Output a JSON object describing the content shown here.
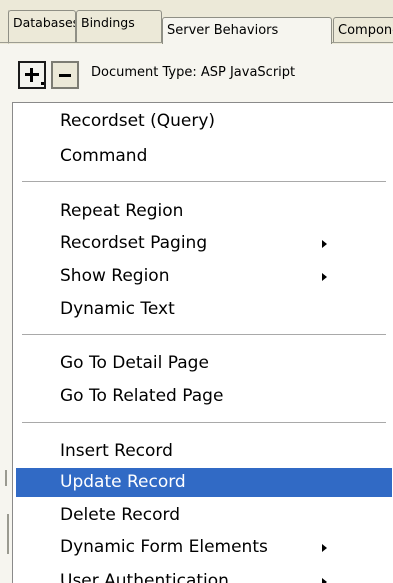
{
  "tabs": [
    {
      "label": "Databases"
    },
    {
      "label": "Bindings"
    },
    {
      "label": "Server Behaviors"
    },
    {
      "label": "Components"
    }
  ],
  "toolbar": {
    "plus_icon": "plus-icon",
    "minus_icon": "minus-icon",
    "document_type": "Document Type: ASP JavaScript"
  },
  "menu": {
    "items": [
      {
        "label": "Recordset (Query)"
      },
      {
        "label": "Command"
      },
      {
        "label": "Repeat Region"
      },
      {
        "label": "Recordset Paging",
        "submenu": true
      },
      {
        "label": "Show Region",
        "submenu": true
      },
      {
        "label": "Dynamic Text"
      },
      {
        "label": "Go To Detail Page"
      },
      {
        "label": "Go To Related Page"
      },
      {
        "label": "Insert Record"
      },
      {
        "label": "Update Record",
        "highlighted": true
      },
      {
        "label": "Delete Record"
      },
      {
        "label": "Dynamic Form Elements",
        "submenu": true
      },
      {
        "label": "User Authentication",
        "submenu": true
      }
    ]
  },
  "colors": {
    "highlight_bg": "#316ac5",
    "highlight_text": "#ffffff",
    "chrome_bg": "#ece9d8"
  }
}
